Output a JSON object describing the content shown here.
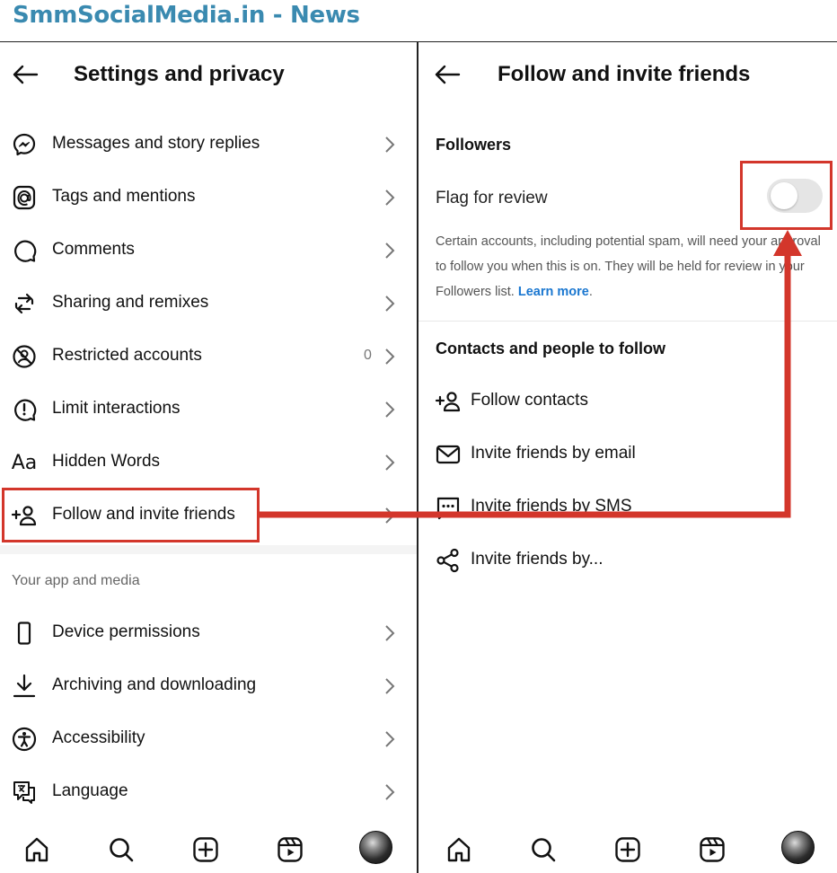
{
  "banner": {
    "text": "SmmSocialMedia.in - News"
  },
  "colors": {
    "banner_text": "#3a8ab0",
    "highlight": "#d3362b",
    "link": "#1a77d0",
    "toggle_off": "#e5e5e5"
  },
  "left_panel": {
    "title": "Settings and privacy",
    "items": [
      {
        "label": "Messages and story replies",
        "icon": "messenger-icon"
      },
      {
        "label": "Tags and mentions",
        "icon": "at-sign-icon"
      },
      {
        "label": "Comments",
        "icon": "comment-icon"
      },
      {
        "label": "Sharing and remixes",
        "icon": "repost-icon"
      },
      {
        "label": "Restricted accounts",
        "icon": "restricted-icon",
        "count": "0"
      },
      {
        "label": "Limit interactions",
        "icon": "limit-icon"
      },
      {
        "label": "Hidden Words",
        "icon": "text-aa-icon",
        "icon_text": "Aa"
      },
      {
        "label": "Follow and invite friends",
        "icon": "add-person-icon"
      }
    ],
    "section_title": "Your app and media",
    "items2": [
      {
        "label": "Device permissions",
        "icon": "phone-icon"
      },
      {
        "label": "Archiving and downloading",
        "icon": "download-icon"
      },
      {
        "label": "Accessibility",
        "icon": "accessibility-icon"
      },
      {
        "label": "Language",
        "icon": "translate-icon"
      }
    ]
  },
  "right_panel": {
    "title": "Follow and invite friends",
    "followers_heading": "Followers",
    "flag_label": "Flag for review",
    "flag_on": false,
    "desc_text": "Certain accounts, including potential spam, will need your approval to follow you when this is on. They will be held for review in your Followers list.",
    "desc_link": "Learn more",
    "contacts_heading": "Contacts and people to follow",
    "items": [
      {
        "label": "Follow contacts",
        "icon": "add-person-icon"
      },
      {
        "label": "Invite friends by email",
        "icon": "email-icon"
      },
      {
        "label": "Invite friends by SMS",
        "icon": "sms-icon"
      },
      {
        "label": "Invite friends by...",
        "icon": "share-icon"
      }
    ]
  },
  "bottom_nav": [
    "home-icon",
    "search-icon",
    "create-icon",
    "reels-icon",
    "profile-avatar"
  ]
}
